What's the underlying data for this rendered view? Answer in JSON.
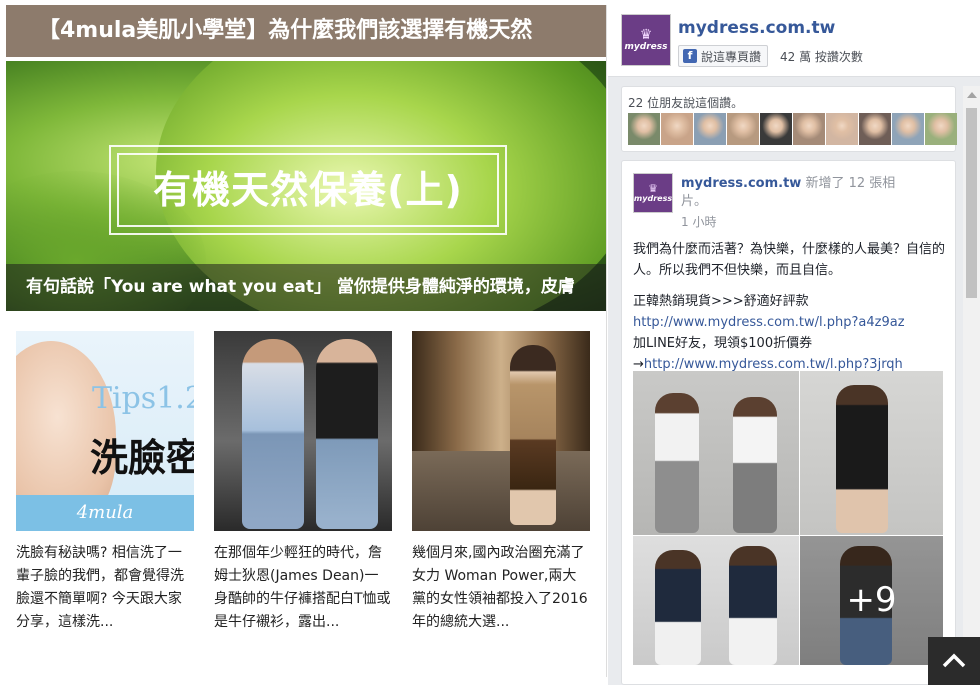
{
  "article": {
    "title": "【4mula美肌小學堂】為什麼我們該選擇有機天然",
    "hero_title": "有機天然保養(上)",
    "hero_caption": "有句話說「You are what you eat」 當你提供身體純淨的環境，皮膚"
  },
  "cards": [
    {
      "thumb_tips": "Tips1.2",
      "thumb_wash": "洗臉密",
      "thumb_brand": "4mula",
      "desc": "洗臉有秘訣嗎? 相信洗了一輩子臉的我們，都會覺得洗臉還不簡單啊? 今天跟大家分享，這樣洗..."
    },
    {
      "desc": "在那個年少輕狂的時代，詹姆士狄恩(James Dean)一身酷帥的牛仔褲搭配白T恤或是牛仔襯衫，露出..."
    },
    {
      "desc": "幾個月來,國內政治圈充滿了女力 Woman Power,兩大黨的女性領袖都投入了2016年的總統大選..."
    }
  ],
  "fb": {
    "page_name": "mydress.com.tw",
    "logo_text": "mydress",
    "like_button": "說這專頁讚",
    "likes_count": "42 萬 按讚次數",
    "friends_text": "22 位朋友說這個讚。",
    "avatar_colors": [
      "#7a8a6a",
      "#c9a489",
      "#8b9fb3",
      "#b79a80",
      "#3a3a3a",
      "#a58b78",
      "#d2b6a2",
      "#6f5e57",
      "#8fa4b8",
      "#9ab07c"
    ],
    "post": {
      "page_name": "mydress.com.tw",
      "action": "新增了 12 張相片。",
      "time": "1 小時",
      "line1": "我們為什麼而活著？為快樂，什麼樣的人最美？自信的人。所以我們不但快樂，而且自信。",
      "line2": "正韓熱銷現貨>>>舒適好評款",
      "link1": "http://www.mydress.com.tw/l.php?a4z9az",
      "line3": "加LINE好友，現領$100折價券",
      "arrow": "→",
      "link2": "http://www.mydress.com.tw/l.php?3jrqh",
      "more_photos": "+9"
    }
  },
  "colors": {
    "title_bar": "#8d7b6c",
    "fb_link": "#365899",
    "brand_purple": "#6b3d86"
  }
}
